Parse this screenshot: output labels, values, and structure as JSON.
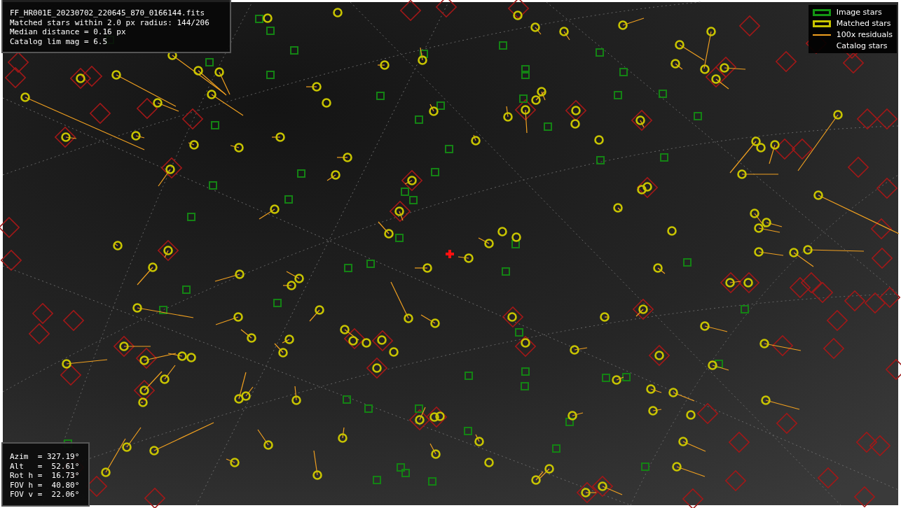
{
  "info_box": {
    "lines": [
      "FF_HR001E_20230702_220645_870_0166144.fits",
      "Matched stars within 2.0 px radius: 144/206",
      "Median distance = 0.16 px",
      "Catalog lim mag = 6.5"
    ]
  },
  "legend": {
    "items": [
      {
        "kind": "image",
        "label": "Image stars"
      },
      {
        "kind": "matched",
        "label": "Matched stars"
      },
      {
        "kind": "residual",
        "label": "100x residuals"
      },
      {
        "kind": "catalog",
        "label": "Catalog stars"
      }
    ]
  },
  "pointing_box": {
    "lines": [
      "Azim  = 327.19°",
      "Alt   =  52.61°",
      "Rot h =  16.73°",
      "FOV h =  40.80°",
      "FOV v =  22.06°"
    ]
  }
}
